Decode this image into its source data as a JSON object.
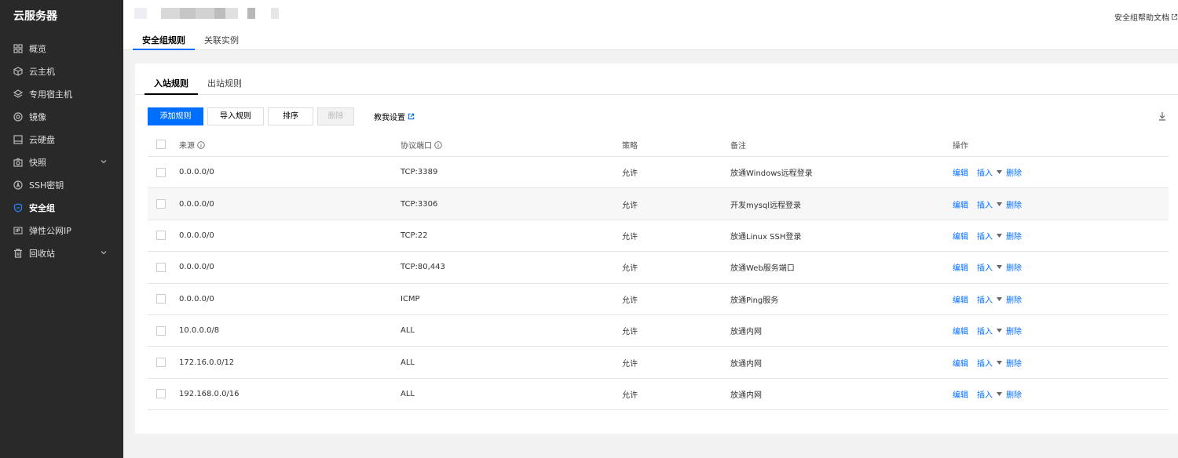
{
  "sidebar": {
    "brand": "云服务器",
    "items": [
      {
        "label": "概览",
        "icon": "grid-icon"
      },
      {
        "label": "云主机",
        "icon": "cube-icon"
      },
      {
        "label": "专用宿主机",
        "icon": "layers-icon"
      },
      {
        "label": "镜像",
        "icon": "disc-icon"
      },
      {
        "label": "云硬盘",
        "icon": "disk-icon"
      },
      {
        "label": "快照",
        "icon": "camera-icon"
      },
      {
        "label": "SSH密钥",
        "icon": "key-icon"
      },
      {
        "label": "安全组",
        "icon": "shield-icon"
      },
      {
        "label": "弹性公网IP",
        "icon": "ip-icon"
      },
      {
        "label": "回收站",
        "icon": "trash-icon"
      }
    ]
  },
  "header": {
    "help_link": "安全组帮助文档",
    "tabs": [
      "安全组规则",
      "关联实例"
    ]
  },
  "card": {
    "tabs": [
      "入站规则",
      "出站规则"
    ],
    "toolbar": {
      "add": "添加规则",
      "import": "导入规则",
      "sort": "排序",
      "delete": "删除",
      "config_link": "教我设置"
    },
    "columns": {
      "source": "来源",
      "port": "协议端口",
      "policy": "策略",
      "note": "备注",
      "ops": "操作"
    },
    "ops": {
      "edit": "编辑",
      "insert": "插入",
      "delete": "删除"
    },
    "rows": [
      {
        "source": "0.0.0.0/0",
        "port": "TCP:3389",
        "policy": "允许",
        "note": "放通Windows远程登录"
      },
      {
        "source": "0.0.0.0/0",
        "port": "TCP:3306",
        "policy": "允许",
        "note": "开发mysql远程登录"
      },
      {
        "source": "0.0.0.0/0",
        "port": "TCP:22",
        "policy": "允许",
        "note": "放通Linux SSH登录"
      },
      {
        "source": "0.0.0.0/0",
        "port": "TCP:80,443",
        "policy": "允许",
        "note": "放通Web服务端口"
      },
      {
        "source": "0.0.0.0/0",
        "port": "ICMP",
        "policy": "允许",
        "note": "放通Ping服务"
      },
      {
        "source": "10.0.0.0/8",
        "port": "ALL",
        "policy": "允许",
        "note": "放通内网"
      },
      {
        "source": "172.16.0.0/12",
        "port": "ALL",
        "policy": "允许",
        "note": "放通内网"
      },
      {
        "source": "192.168.0.0/16",
        "port": "ALL",
        "policy": "允许",
        "note": "放通内网"
      }
    ]
  },
  "colors": {
    "accent": "#006eff",
    "sidebar_bg": "#292929"
  }
}
